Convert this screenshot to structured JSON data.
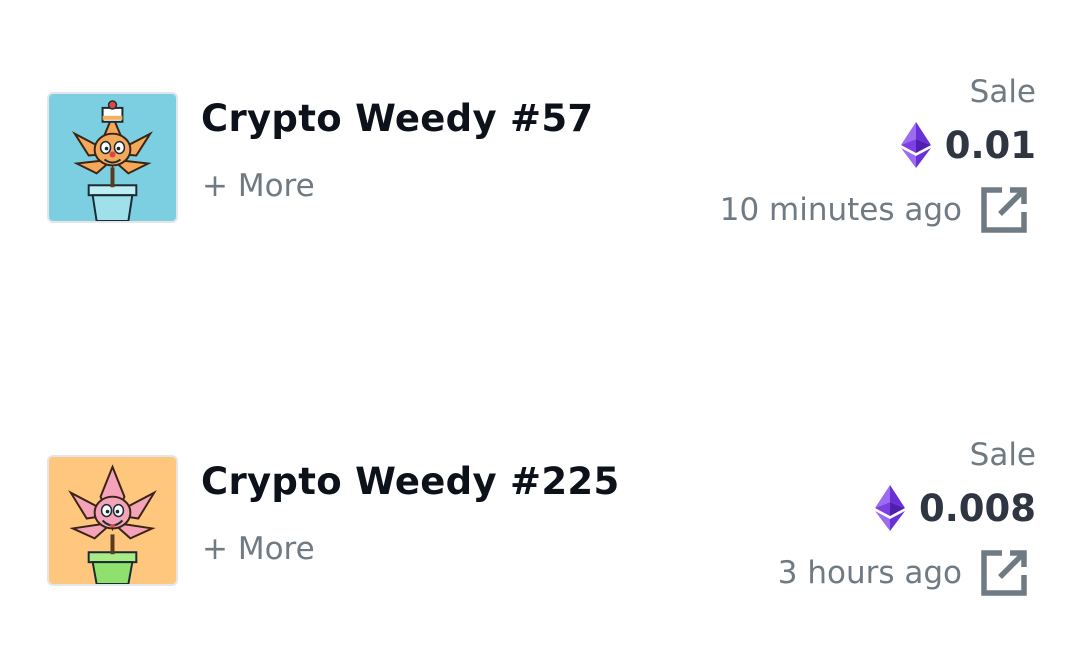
{
  "activity": [
    {
      "name": "Crypto Weedy #57",
      "more_label": "+ More",
      "event": "Sale",
      "price": "0.01",
      "currency_icon": "ethereum-icon",
      "time": "10 minutes ago",
      "link_icon": "open-in-new-icon",
      "thumbnail": {
        "bg": "#7ccfe0",
        "leaf": "#f4a85a",
        "pot": "#9fe0ea",
        "hat": true
      }
    },
    {
      "name": "Crypto Weedy #225",
      "more_label": "+ More",
      "event": "Sale",
      "price": "0.008",
      "currency_icon": "ethereum-icon",
      "time": "3 hours ago",
      "link_icon": "open-in-new-icon",
      "thumbnail": {
        "bg": "#ffc67e",
        "leaf": "#f4a3b8",
        "pot": "#8fe06d",
        "hat": false
      }
    }
  ],
  "colors": {
    "title": "#0d111a",
    "muted": "#707a83",
    "price": "#2f3541",
    "eth_purple": "#7b3fe4"
  }
}
